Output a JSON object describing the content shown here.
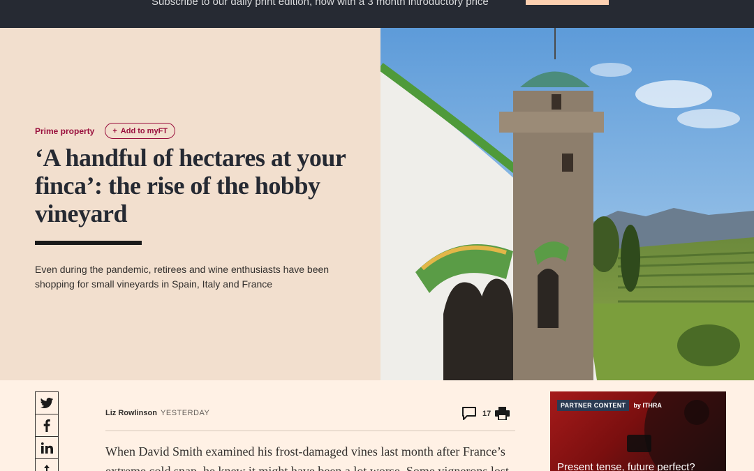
{
  "banner": {
    "text": "Subscribe to our daily print edition, now with a 3 month introductory price"
  },
  "article": {
    "topic": "Prime property",
    "myft_label": "Add to myFT",
    "headline": "‘A handful of hectares at your finca’: the rise of the hobby vineyard",
    "standfirst": "Even during the pandemic, retirees and wine enthusiasts have been shopping for small vineyards in Spain, Italy and France",
    "author": "Liz Rowlinson",
    "date": "YESTERDAY",
    "comment_count": "17",
    "body_excerpt": "When David Smith examined his frost-damaged vines last month after France’s extreme cold snap, he knew it might have been a lot worse. Some vignerons lost"
  },
  "share": {
    "items": [
      "twitter-icon",
      "facebook-icon",
      "linkedin-icon",
      "share-icon"
    ]
  },
  "ad": {
    "badge": "PARTNER CONTENT",
    "sponsor": "by ITHRA",
    "headline": "Present tense, future perfect?"
  },
  "colors": {
    "banner_bg": "#262a33",
    "banner_button": "#fcd0b1",
    "page_bg": "#fff1e5",
    "hero_bg": "#f2dfce",
    "accent": "#990f3d",
    "text": "#33302e"
  }
}
